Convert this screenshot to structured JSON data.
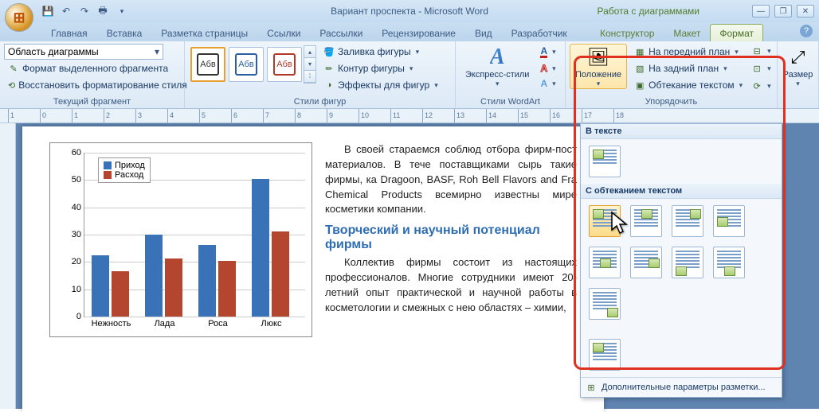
{
  "title": "Вариант проспекта - Microsoft Word",
  "context_title": "Работа с диаграммами",
  "qat": [
    "save",
    "undo",
    "redo",
    "print",
    "sep"
  ],
  "tabs": {
    "main": [
      "Главная",
      "Вставка",
      "Разметка страницы",
      "Ссылки",
      "Рассылки",
      "Рецензирование",
      "Вид",
      "Разработчик"
    ],
    "context": [
      "Конструктор",
      "Макет",
      "Формат"
    ],
    "active": "Формат"
  },
  "ribbon": {
    "group1": {
      "label": "Текущий фрагмент",
      "chart_area": "Область диаграммы",
      "fmt_sel": "Формат выделенного фрагмента",
      "reset": "Восстановить форматирование стиля"
    },
    "group2": {
      "label": "Стили фигур",
      "sample": "Абв",
      "fill": "Заливка фигуры",
      "outline": "Контур фигуры",
      "effects": "Эффекты для фигур"
    },
    "group3": {
      "label": "Стили WordArt",
      "express": "Экспресс-стили"
    },
    "group4": {
      "label": "Упорядочить",
      "position": "Положение",
      "front": "На передний план",
      "back": "На задний план",
      "wrap": "Обтекание текстом"
    },
    "group5": {
      "label": "Размер"
    }
  },
  "pos_panel": {
    "h1": "В тексте",
    "h2": "С обтеканием текстом",
    "footer": "Дополнительные параметры разметки..."
  },
  "chart_data": {
    "type": "bar",
    "categories": [
      "Нежность",
      "Лада",
      "Роса",
      "Люкс"
    ],
    "series": [
      {
        "name": "Приход",
        "color": "#3a72b8",
        "values": [
          23,
          31,
          27,
          52
        ]
      },
      {
        "name": "Расход",
        "color": "#b4452f",
        "values": [
          17,
          22,
          21,
          32
        ]
      }
    ],
    "ylim": [
      0,
      60
    ],
    "ystep": 10
  },
  "doc": {
    "heading": "Творческий и научный потенциал фирмы",
    "para1_words": [
      "В",
      "своей"
    ],
    "para1_rest": "стараемся соблюд отбора фирм-пост материалов. В тече поставщиками сырь такие фирмы, ка Dragoon, BASF, Roh Bell Flavors and Fra Chemical Products всемирно известны мире косметики компании.",
    "para2": "Коллектив фирмы состоит из настоящих профессионалов. Многие сотрудники имеют 20-летний опыт практической и научной работы в косметологии и смежных с нею областях – химии,"
  }
}
